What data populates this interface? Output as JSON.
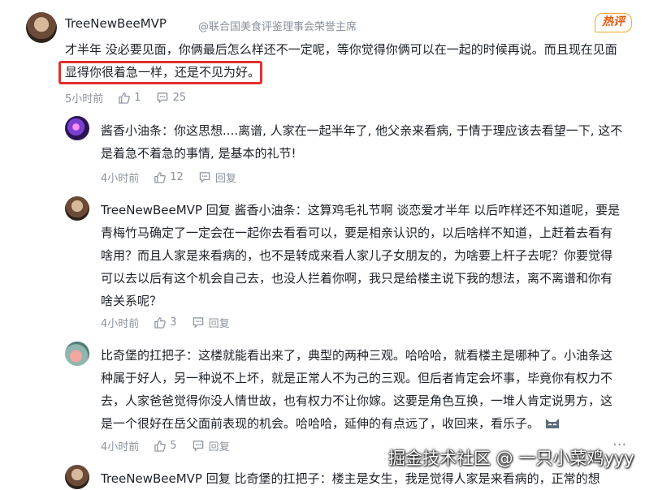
{
  "main_comment": {
    "user": "TreeNewBeeMVP",
    "title": "@联合国美食评鉴理事会荣誉主席",
    "badge": "热评",
    "line1": "才半年 没必要见面，你俩最后怎么样还不一定呢，等你觉得你俩可以在一起的时候再说。而且现在见面",
    "line2": "显得你很着急一样，还是不见为好。",
    "time": "5小时前",
    "likes": "1",
    "comments": "25"
  },
  "replies": [
    {
      "user": "酱香小油条",
      "reply_word": "",
      "reply_to": "",
      "lines": [
        "你这思想....离谱, 人家在一起半年了, 他父亲来看病, 于情于理应该去看望一下, 这不",
        "是着急不着急的事情, 是基本的礼节!"
      ],
      "time": "4小时前",
      "likes": "12",
      "reply_label": "回复"
    },
    {
      "user": "TreeNewBeeMVP",
      "reply_word": "回复",
      "reply_to": "酱香小油条",
      "lines": [
        "这算鸡毛礼节啊 谈恋爱才半年 以后咋样还不知道呢，要是",
        "青梅竹马确定了一定会在一起你去看看可以，要是相亲认识的，以后啥样不知道，上赶着去看有",
        "啥用？而且人家是来看病的，也不是转成来看人家儿子女朋友的，为啥要上杆子去呢？你要觉得",
        "可以去以后有这个机会自己去，也没人拦着你啊，我只是给楼主说下我的想法，离不离谱和你有",
        "啥关系呢？"
      ],
      "time": "4小时前",
      "likes": "3",
      "reply_label": "回复"
    },
    {
      "user": "比奇堡的扛把子",
      "reply_word": "",
      "reply_to": "",
      "lines": [
        "这楼就能看出来了，典型的两种三观。哈哈哈，就看楼主是哪种了。小油条这",
        "种属于好人，另一种说不上坏，就是正常人不为己的三观。但后者肯定会坏事，毕竟你有权力不",
        "去，人家爸爸觉得你没人情世故，也有权力不让你嫁。这要是角色互换，一堆人肯定说男方，这",
        "是一个很好在岳父面前表现的机会。哈哈哈，延伸的有点远了，收回来，看乐子。"
      ],
      "time": "4小时前",
      "likes": "5",
      "reply_label": "回复"
    },
    {
      "user": "TreeNewBeeMVP",
      "reply_word": "回复",
      "reply_to": "比奇堡的扛把子",
      "lines": [
        "楼主是女生，我是觉得人家是来看病的，正常的想"
      ],
      "time": "",
      "likes": "",
      "reply_label": ""
    }
  ],
  "watermark": "掘金技术社区 @ 一只小菜鸡yyy",
  "more": "···"
}
